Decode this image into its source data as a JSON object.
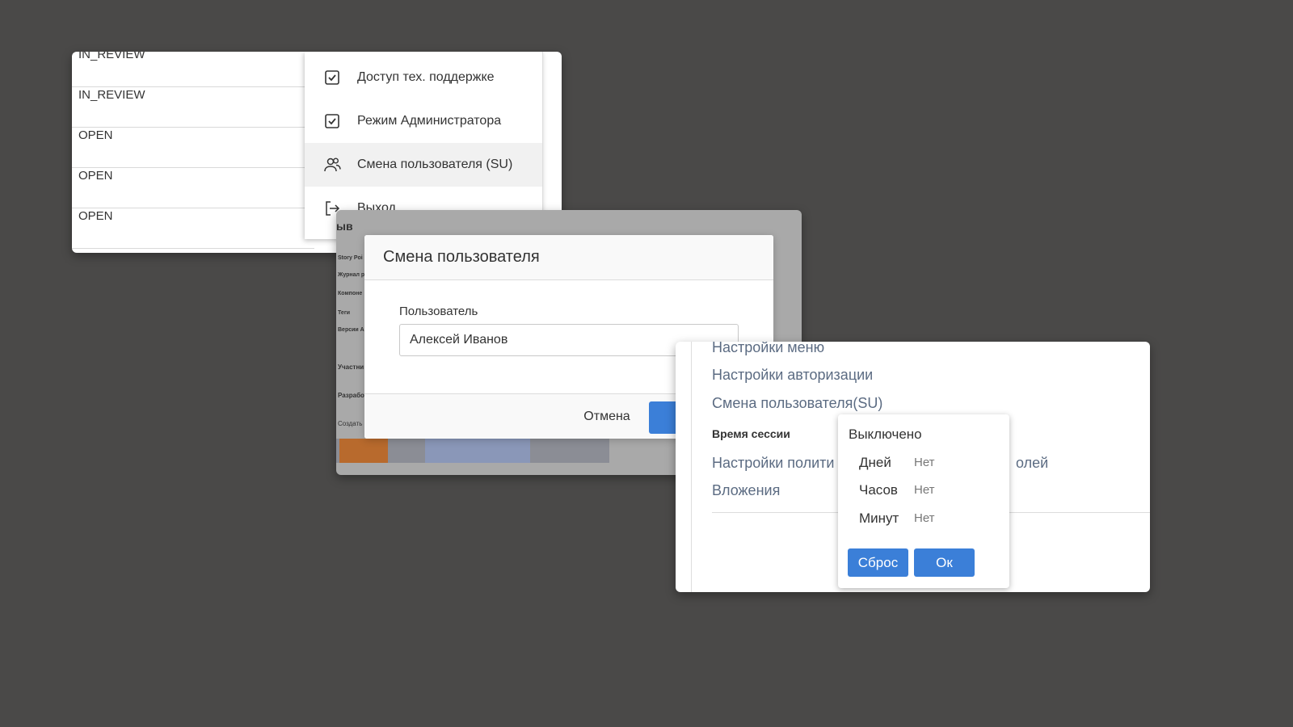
{
  "status_list": {
    "rows": [
      "IN_REVIEW",
      "IN_REVIEW",
      "OPEN",
      "OPEN",
      "OPEN"
    ]
  },
  "user_menu": {
    "items": [
      {
        "label": "Доступ тех. поддержке",
        "icon": "checkbox-checked-icon"
      },
      {
        "label": "Режим Администратора",
        "icon": "checkbox-checked-icon"
      },
      {
        "label": "Смена пользователя (SU)",
        "icon": "users-icon"
      },
      {
        "label": "Выход",
        "icon": "logout-icon"
      }
    ]
  },
  "background_page": {
    "heading_fragment": "ыв",
    "labels": [
      "Story Poi",
      "Журнал р",
      "Компоне",
      "Теги",
      "Версии А"
    ],
    "people_labels": [
      "Участни",
      "Разрабо"
    ],
    "create_link": "Создать"
  },
  "change_user_modal": {
    "title": "Смена пользователя",
    "user_label": "Пользователь",
    "user_value": "Алексей Иванов",
    "cancel_label": "Отмена"
  },
  "settings": {
    "links": [
      "Настройки меню",
      "Настройки авторизации",
      "Смена пользователя(SU)"
    ],
    "session_label": "Время сессии",
    "policy_link_start": "Настройки полити",
    "policy_link_end": "олей",
    "attachments_link": "Вложения"
  },
  "session_popup": {
    "status": "Выключено",
    "rows": [
      {
        "label": "Дней",
        "value": "Нет"
      },
      {
        "label": "Часов",
        "value": "Нет"
      },
      {
        "label": "Минут",
        "value": "Нет"
      }
    ],
    "reset_label": "Сброс",
    "ok_label": "Ок"
  },
  "colors": {
    "background": "#4a4948",
    "accent": "#3b7fd8",
    "link": "#5b6b82"
  }
}
